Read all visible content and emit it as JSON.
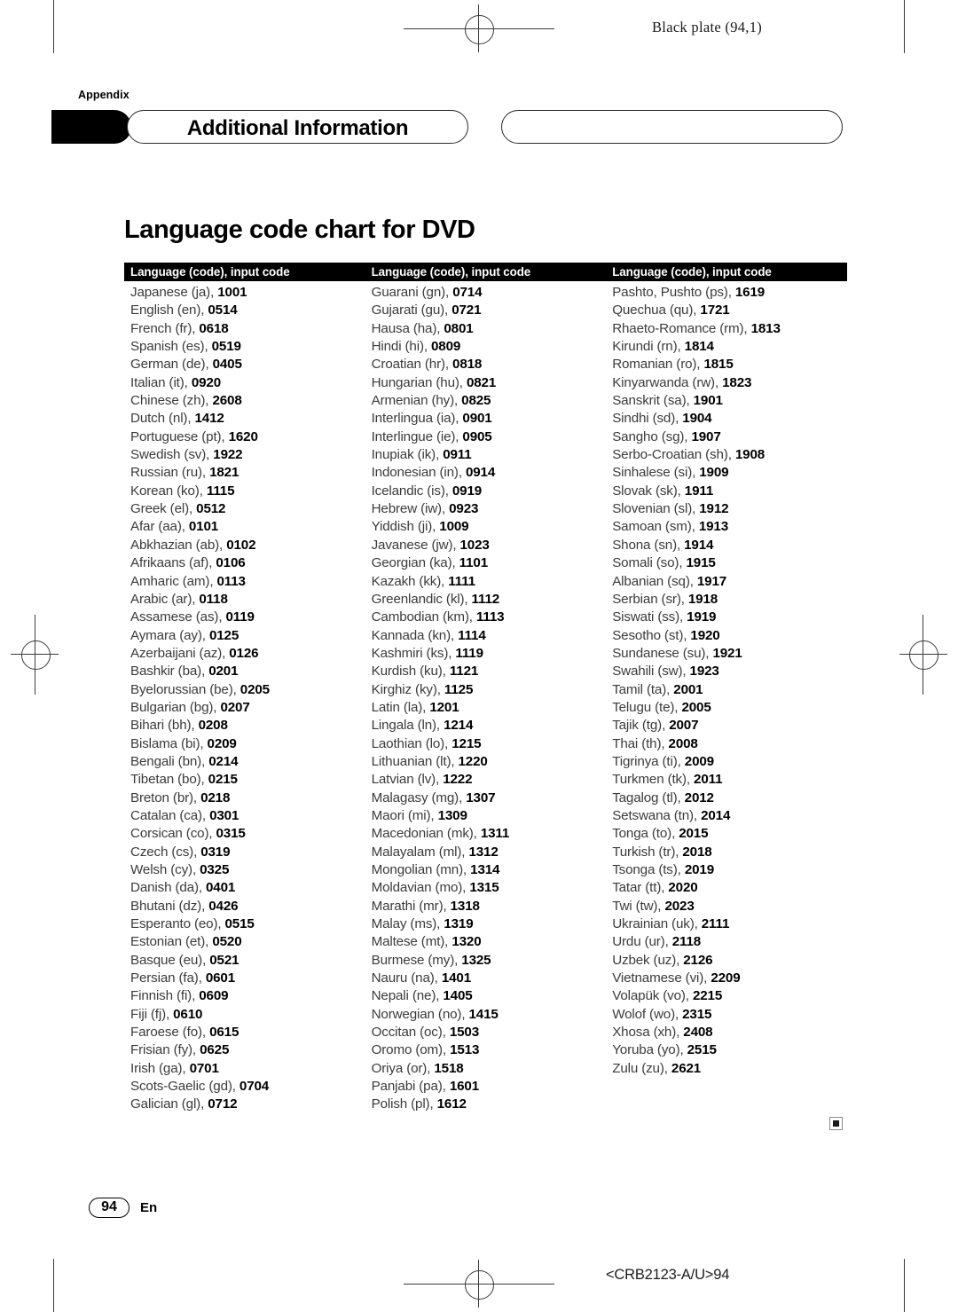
{
  "print_header": {
    "black_plate": "Black plate (94,1)"
  },
  "banner": {
    "appendix_label": "Appendix",
    "title": "Additional Information"
  },
  "section": {
    "title": "Language code chart for DVD"
  },
  "table": {
    "headers": [
      "Language (code), input code",
      "Language (code), input code",
      "Language (code), input code"
    ],
    "columns": [
      [
        {
          "name": "Japanese (ja),",
          "code": "1001"
        },
        {
          "name": "English (en),",
          "code": "0514"
        },
        {
          "name": "French (fr),",
          "code": "0618"
        },
        {
          "name": "Spanish (es),",
          "code": "0519"
        },
        {
          "name": "German (de),",
          "code": "0405"
        },
        {
          "name": "Italian (it),",
          "code": "0920"
        },
        {
          "name": "Chinese (zh),",
          "code": "2608"
        },
        {
          "name": "Dutch (nl),",
          "code": "1412"
        },
        {
          "name": "Portuguese (pt),",
          "code": "1620"
        },
        {
          "name": "Swedish (sv),",
          "code": "1922"
        },
        {
          "name": "Russian (ru),",
          "code": "1821"
        },
        {
          "name": "Korean (ko),",
          "code": "1115"
        },
        {
          "name": "Greek (el),",
          "code": "0512"
        },
        {
          "name": "Afar (aa),",
          "code": "0101"
        },
        {
          "name": "Abkhazian (ab),",
          "code": "0102"
        },
        {
          "name": "Afrikaans (af),",
          "code": "0106"
        },
        {
          "name": "Amharic (am),",
          "code": "0113"
        },
        {
          "name": "Arabic (ar),",
          "code": "0118"
        },
        {
          "name": "Assamese (as),",
          "code": "0119"
        },
        {
          "name": "Aymara (ay),",
          "code": "0125"
        },
        {
          "name": "Azerbaijani (az),",
          "code": "0126"
        },
        {
          "name": "Bashkir (ba),",
          "code": "0201"
        },
        {
          "name": "Byelorussian (be),",
          "code": "0205"
        },
        {
          "name": "Bulgarian (bg),",
          "code": "0207"
        },
        {
          "name": "Bihari (bh),",
          "code": "0208"
        },
        {
          "name": "Bislama (bi),",
          "code": "0209"
        },
        {
          "name": "Bengali (bn),",
          "code": "0214"
        },
        {
          "name": "Tibetan (bo),",
          "code": "0215"
        },
        {
          "name": "Breton (br),",
          "code": "0218"
        },
        {
          "name": "Catalan (ca),",
          "code": "0301"
        },
        {
          "name": "Corsican (co),",
          "code": "0315"
        },
        {
          "name": "Czech (cs),",
          "code": "0319"
        },
        {
          "name": "Welsh (cy),",
          "code": "0325"
        },
        {
          "name": "Danish (da),",
          "code": "0401"
        },
        {
          "name": "Bhutani (dz),",
          "code": "0426"
        },
        {
          "name": "Esperanto (eo),",
          "code": "0515"
        },
        {
          "name": "Estonian (et),",
          "code": "0520"
        },
        {
          "name": "Basque (eu),",
          "code": "0521"
        },
        {
          "name": "Persian (fa),",
          "code": "0601"
        },
        {
          "name": "Finnish (fi),",
          "code": "0609"
        },
        {
          "name": "Fiji (fj),",
          "code": "0610"
        },
        {
          "name": "Faroese (fo),",
          "code": "0615"
        },
        {
          "name": "Frisian (fy),",
          "code": "0625"
        },
        {
          "name": "Irish (ga),",
          "code": "0701"
        },
        {
          "name": "Scots-Gaelic (gd),",
          "code": "0704"
        },
        {
          "name": "Galician (gl),",
          "code": "0712"
        }
      ],
      [
        {
          "name": "Guarani (gn),",
          "code": "0714"
        },
        {
          "name": "Gujarati (gu),",
          "code": "0721"
        },
        {
          "name": "Hausa (ha),",
          "code": "0801"
        },
        {
          "name": "Hindi (hi),",
          "code": "0809"
        },
        {
          "name": "Croatian (hr),",
          "code": "0818"
        },
        {
          "name": "Hungarian (hu),",
          "code": "0821"
        },
        {
          "name": "Armenian (hy),",
          "code": "0825"
        },
        {
          "name": "Interlingua (ia),",
          "code": "0901"
        },
        {
          "name": "Interlingue (ie),",
          "code": "0905"
        },
        {
          "name": "Inupiak (ik),",
          "code": "0911"
        },
        {
          "name": "Indonesian (in),",
          "code": "0914"
        },
        {
          "name": "Icelandic (is),",
          "code": "0919"
        },
        {
          "name": "Hebrew (iw),",
          "code": "0923"
        },
        {
          "name": "Yiddish (ji),",
          "code": "1009"
        },
        {
          "name": "Javanese (jw),",
          "code": "1023"
        },
        {
          "name": "Georgian (ka),",
          "code": "1101"
        },
        {
          "name": "Kazakh (kk),",
          "code": "1111"
        },
        {
          "name": "Greenlandic (kl),",
          "code": "1112"
        },
        {
          "name": "Cambodian (km),",
          "code": "1113"
        },
        {
          "name": "Kannada (kn),",
          "code": "1114"
        },
        {
          "name": "Kashmiri (ks),",
          "code": "1119"
        },
        {
          "name": "Kurdish (ku),",
          "code": "1121"
        },
        {
          "name": "Kirghiz (ky),",
          "code": "1125"
        },
        {
          "name": "Latin (la),",
          "code": "1201"
        },
        {
          "name": "Lingala (ln),",
          "code": "1214"
        },
        {
          "name": "Laothian (lo),",
          "code": "1215"
        },
        {
          "name": "Lithuanian (lt),",
          "code": "1220"
        },
        {
          "name": "Latvian (lv),",
          "code": "1222"
        },
        {
          "name": "Malagasy (mg),",
          "code": "1307"
        },
        {
          "name": "Maori (mi),",
          "code": "1309"
        },
        {
          "name": "Macedonian (mk),",
          "code": "1311"
        },
        {
          "name": "Malayalam (ml),",
          "code": "1312"
        },
        {
          "name": "Mongolian (mn),",
          "code": "1314"
        },
        {
          "name": "Moldavian (mo),",
          "code": "1315"
        },
        {
          "name": "Marathi (mr),",
          "code": "1318"
        },
        {
          "name": "Malay (ms),",
          "code": "1319"
        },
        {
          "name": "Maltese (mt),",
          "code": "1320"
        },
        {
          "name": "Burmese (my),",
          "code": "1325"
        },
        {
          "name": "Nauru (na),",
          "code": "1401"
        },
        {
          "name": "Nepali (ne),",
          "code": "1405"
        },
        {
          "name": "Norwegian (no),",
          "code": "1415"
        },
        {
          "name": "Occitan (oc),",
          "code": "1503"
        },
        {
          "name": "Oromo (om),",
          "code": "1513"
        },
        {
          "name": "Oriya (or),",
          "code": "1518"
        },
        {
          "name": "Panjabi (pa),",
          "code": "1601"
        },
        {
          "name": "Polish (pl),",
          "code": "1612"
        }
      ],
      [
        {
          "name": "Pashto, Pushto (ps),",
          "code": "1619"
        },
        {
          "name": "Quechua (qu),",
          "code": "1721"
        },
        {
          "name": "Rhaeto-Romance (rm),",
          "code": "1813"
        },
        {
          "name": "Kirundi (rn),",
          "code": "1814"
        },
        {
          "name": "Romanian (ro),",
          "code": "1815"
        },
        {
          "name": "Kinyarwanda (rw),",
          "code": "1823"
        },
        {
          "name": "Sanskrit (sa),",
          "code": "1901"
        },
        {
          "name": "Sindhi (sd),",
          "code": "1904"
        },
        {
          "name": "Sangho (sg),",
          "code": "1907"
        },
        {
          "name": "Serbo-Croatian (sh),",
          "code": "1908"
        },
        {
          "name": "Sinhalese (si),",
          "code": "1909"
        },
        {
          "name": "Slovak (sk),",
          "code": "1911"
        },
        {
          "name": "Slovenian (sl),",
          "code": "1912"
        },
        {
          "name": "Samoan (sm),",
          "code": "1913"
        },
        {
          "name": "Shona (sn),",
          "code": "1914"
        },
        {
          "name": "Somali (so),",
          "code": "1915"
        },
        {
          "name": "Albanian (sq),",
          "code": "1917"
        },
        {
          "name": "Serbian (sr),",
          "code": "1918"
        },
        {
          "name": "Siswati (ss),",
          "code": "1919"
        },
        {
          "name": "Sesotho (st),",
          "code": "1920"
        },
        {
          "name": "Sundanese (su),",
          "code": "1921"
        },
        {
          "name": "Swahili (sw),",
          "code": "1923"
        },
        {
          "name": "Tamil (ta),",
          "code": "2001"
        },
        {
          "name": "Telugu (te),",
          "code": "2005"
        },
        {
          "name": "Tajik (tg),",
          "code": "2007"
        },
        {
          "name": "Thai (th),",
          "code": "2008"
        },
        {
          "name": "Tigrinya (ti),",
          "code": "2009"
        },
        {
          "name": "Turkmen (tk),",
          "code": "2011"
        },
        {
          "name": "Tagalog (tl),",
          "code": "2012"
        },
        {
          "name": "Setswana (tn),",
          "code": "2014"
        },
        {
          "name": "Tonga (to),",
          "code": "2015"
        },
        {
          "name": "Turkish (tr),",
          "code": "2018"
        },
        {
          "name": "Tsonga (ts),",
          "code": "2019"
        },
        {
          "name": "Tatar (tt),",
          "code": "2020"
        },
        {
          "name": "Twi (tw),",
          "code": "2023"
        },
        {
          "name": "Ukrainian (uk),",
          "code": "2111"
        },
        {
          "name": "Urdu (ur),",
          "code": "2118"
        },
        {
          "name": "Uzbek (uz),",
          "code": "2126"
        },
        {
          "name": "Vietnamese (vi),",
          "code": "2209"
        },
        {
          "name": "Volapük (vo),",
          "code": "2215"
        },
        {
          "name": "Wolof (wo),",
          "code": "2315"
        },
        {
          "name": "Xhosa (xh),",
          "code": "2408"
        },
        {
          "name": "Yoruba (yo),",
          "code": "2515"
        },
        {
          "name": "Zulu (zu),",
          "code": "2621"
        }
      ]
    ]
  },
  "footer": {
    "page_number": "94",
    "language": "En",
    "doc_code": "<CRB2123-A/U>94"
  }
}
